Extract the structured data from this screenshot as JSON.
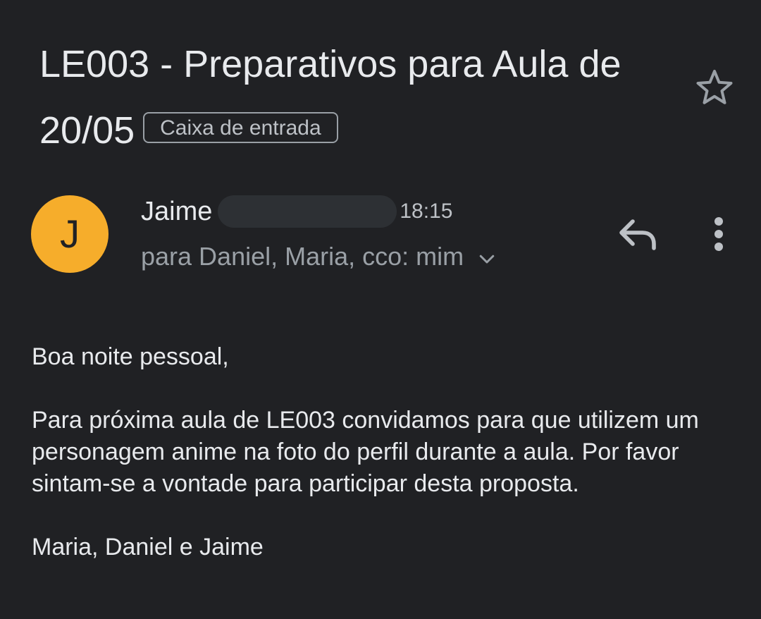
{
  "email": {
    "subject": "LE003 - Preparativos para Aula de 20/05",
    "label": "Caixa de entrada",
    "sender": {
      "initial": "J",
      "name": "Jaime",
      "avatar_color": "#f6ad2b"
    },
    "time": "18:15",
    "recipients": "para Daniel, Maria, cco: mim",
    "body": {
      "greeting": "Boa noite pessoal,",
      "paragraph": "Para próxima aula de LE003 convidamos para que utilizem um personagem anime na foto do perfil durante a aula. Por favor sintam-se a vontade para participar desta proposta.",
      "signature": "Maria, Daniel e Jaime"
    }
  },
  "icons": {
    "star": "star-outline-icon",
    "reply": "reply-icon",
    "more": "more-vertical-icon",
    "expand": "chevron-down-icon"
  },
  "colors": {
    "background": "#202124",
    "text_primary": "#e8eaed",
    "text_secondary": "#9aa0a6"
  }
}
